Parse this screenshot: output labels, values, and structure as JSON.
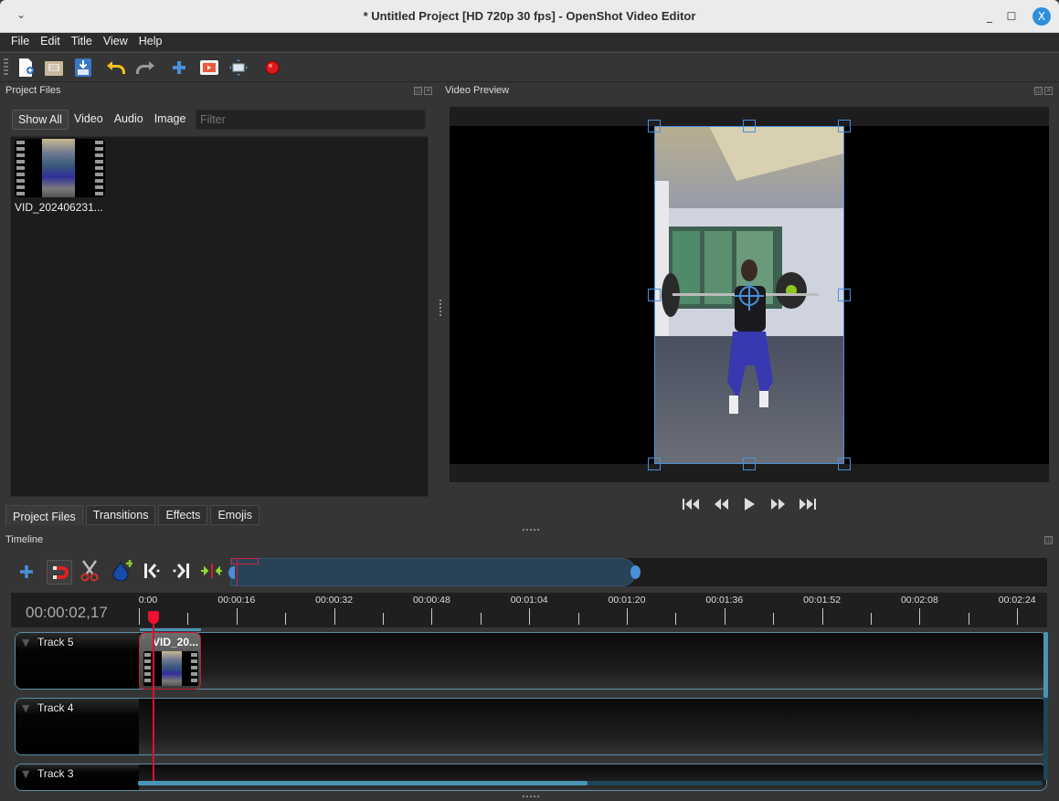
{
  "window": {
    "title": "* Untitled Project [HD 720p 30 fps] - OpenShot Video Editor",
    "menu_icon": "chevron-down",
    "minimize": "_",
    "maximize": "☐",
    "close": "X"
  },
  "menubar": {
    "items": [
      "File",
      "Edit",
      "Title",
      "View",
      "Help"
    ]
  },
  "toolbar": {
    "items": [
      {
        "name": "new-project",
        "icon": "new-file-icon"
      },
      {
        "name": "open-project",
        "icon": "folder-icon"
      },
      {
        "name": "save-project",
        "icon": "save-icon"
      },
      {
        "name": "undo",
        "icon": "undo-icon"
      },
      {
        "name": "redo",
        "icon": "redo-icon"
      },
      {
        "name": "import-files",
        "icon": "plus-icon"
      },
      {
        "name": "choose-profile",
        "icon": "video-profile-icon"
      },
      {
        "name": "fullscreen",
        "icon": "fullscreen-icon"
      },
      {
        "name": "export-video",
        "icon": "record-icon"
      }
    ]
  },
  "project_files": {
    "title": "Project Files",
    "filters": [
      "Show All",
      "Video",
      "Audio",
      "Image"
    ],
    "active_filter": "Show All",
    "filter_placeholder": "Filter",
    "files": [
      {
        "name": "VID_202406231..."
      }
    ]
  },
  "dock_tabs": {
    "items": [
      "Project Files",
      "Transitions",
      "Effects",
      "Emojis"
    ],
    "active": "Project Files"
  },
  "video_preview": {
    "title": "Video Preview",
    "controls": [
      "jump-start",
      "rewind",
      "play",
      "fast-forward",
      "jump-end"
    ]
  },
  "timeline": {
    "title": "Timeline",
    "timecode": "00:00:02,17",
    "tools": [
      "add-track",
      "snapping",
      "razor",
      "add-marker",
      "previous-marker",
      "next-marker",
      "center-playhead"
    ],
    "ruler_labels": [
      "0:00",
      "00:00:16",
      "00:00:32",
      "00:00:48",
      "00:01:04",
      "00:01:20",
      "00:01:36",
      "00:01:52",
      "00:02:08",
      "00:02:24"
    ],
    "tracks": [
      {
        "name": "Track 5"
      },
      {
        "name": "Track 4"
      },
      {
        "name": "Track 3"
      }
    ],
    "clips": [
      {
        "title": "VID_20...",
        "track": "Track 5"
      }
    ],
    "accent": "#4a95b5",
    "playhead_color": "#e0102a"
  }
}
